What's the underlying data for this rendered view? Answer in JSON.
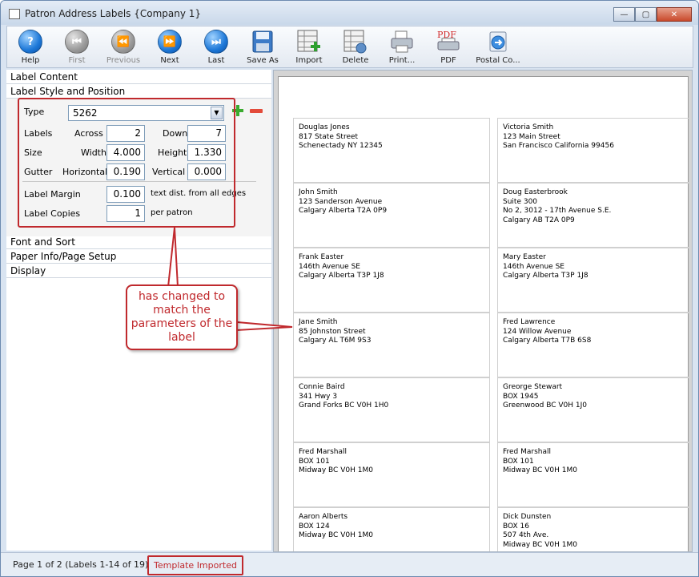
{
  "window": {
    "title": "Patron Address Labels {Company 1}",
    "buttons": {
      "minimize": "—",
      "maximize": "▢",
      "close": "✕"
    }
  },
  "toolbar": [
    {
      "name": "help",
      "label": "Help",
      "icon": "help-icon",
      "enabled": true
    },
    {
      "name": "first",
      "label": "First",
      "icon": "first-icon",
      "enabled": false
    },
    {
      "name": "previous",
      "label": "Previous",
      "icon": "previous-icon",
      "enabled": false
    },
    {
      "name": "next",
      "label": "Next",
      "icon": "next-icon",
      "enabled": true
    },
    {
      "name": "last",
      "label": "Last",
      "icon": "last-icon",
      "enabled": true
    },
    {
      "name": "save-as",
      "label": "Save As",
      "icon": "floppy-disk-icon",
      "enabled": true
    },
    {
      "name": "import",
      "label": "Import",
      "icon": "import-icon",
      "enabled": true
    },
    {
      "name": "delete",
      "label": "Delete",
      "icon": "delete-icon",
      "enabled": true
    },
    {
      "name": "print",
      "label": "Print...",
      "icon": "printer-icon",
      "enabled": true
    },
    {
      "name": "pdf",
      "label": "PDF",
      "icon": "pdf-icon",
      "enabled": true
    },
    {
      "name": "postal",
      "label": "Postal Co...",
      "icon": "postal-icon",
      "enabled": true
    }
  ],
  "sections": {
    "label_content": "Label Content",
    "label_style": "Label Style and Position",
    "font_sort": "Font and Sort",
    "paper_info": "Paper Info/Page Setup",
    "display": "Display"
  },
  "form": {
    "type_label": "Type",
    "type_value": "5262",
    "labels_label": "Labels",
    "across_label": "Across",
    "across_value": "2",
    "down_label": "Down",
    "down_value": "7",
    "size_label": "Size",
    "width_label": "Width",
    "width_value": "4.000",
    "height_label": "Height",
    "height_value": "1.330",
    "gutter_label": "Gutter",
    "horizontal_label": "Horizontal",
    "horizontal_value": "0.190",
    "vertical_label": "Vertical",
    "vertical_value": "0.000",
    "margin_label": "Label Margin",
    "margin_value": "0.100",
    "margin_note": "text dist. from all edges",
    "copies_label": "Label Copies",
    "copies_value": "1",
    "copies_note": "per patron"
  },
  "labels": [
    [
      "Douglas Jones",
      "817 State Street",
      "Schenectady NY 12345"
    ],
    [
      "Victoria Smith",
      "123 Main Street",
      "San Francisco California 99456"
    ],
    [
      "John Smith",
      "123 Sanderson Avenue",
      "Calgary Alberta T2A 0P9"
    ],
    [
      "Doug Easterbrook",
      "Suite 300",
      "No 2, 3012 - 17th Avenue S.E.",
      "Calgary AB T2A 0P9"
    ],
    [
      "Frank Easter",
      "146th Avenue SE",
      "Calgary Alberta T3P 1J8"
    ],
    [
      "Mary Easter",
      "146th Avenue SE",
      "Calgary Alberta T3P 1J8"
    ],
    [
      "Jane Smith",
      "85 Johnston Street",
      "Calgary AL T6M 9S3"
    ],
    [
      "Fred Lawrence",
      "124 Willow Avenue",
      "Calgary Alberta T7B 6S8"
    ],
    [
      "Connie Baird",
      "341 Hwy 3",
      "Grand Forks BC V0H 1H0"
    ],
    [
      "Greorge Stewart",
      "BOX 1945",
      "Greenwood BC V0H 1J0"
    ],
    [
      "Fred Marshall",
      "BOX 101",
      "Midway BC V0H 1M0"
    ],
    [
      "Fred Marshall",
      "BOX 101",
      "Midway BC V0H 1M0"
    ],
    [
      "Aaron Alberts",
      "BOX 124",
      "Midway BC V0H 1M0"
    ],
    [
      "Dick Dunsten",
      "BOX 16",
      "507 4th Ave.",
      "Midway BC V0H 1M0"
    ]
  ],
  "callout": {
    "text": "has changed to match the parameters of the label",
    "color": "#c0292d"
  },
  "status": {
    "page": "Page 1 of 2 (Labels 1-14 of 19)",
    "template": "Template Imported"
  }
}
